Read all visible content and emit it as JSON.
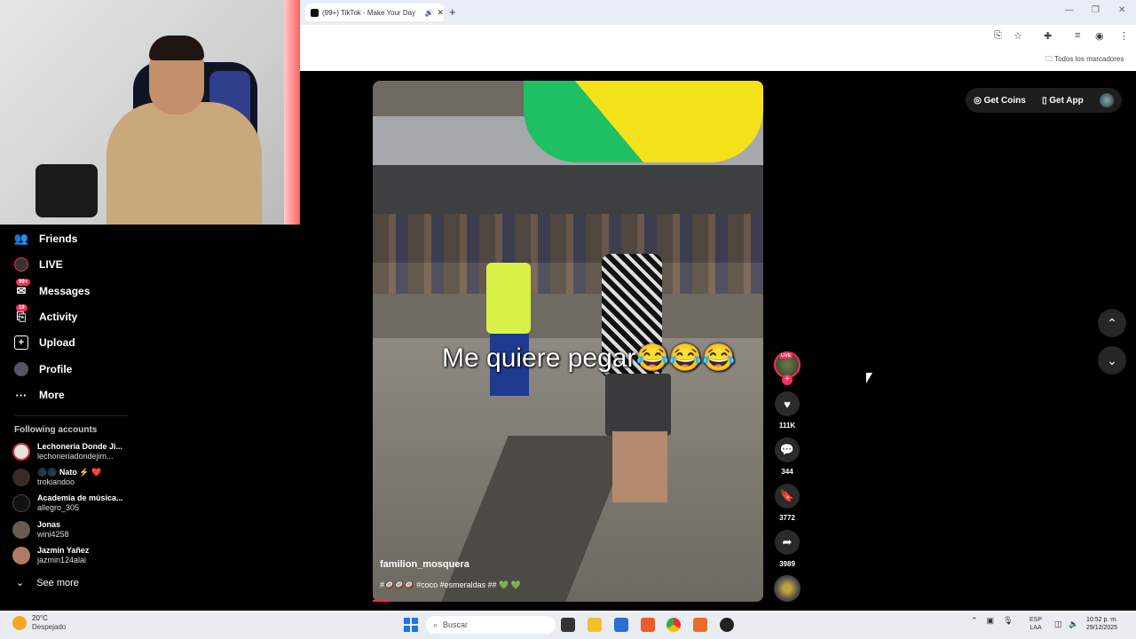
{
  "browser": {
    "tab_title": "(99+) TikTok - Make Your Day",
    "new_tab": "+",
    "tab_close": "✕",
    "bookmarks_label": "Todos los marcadores",
    "window_controls": [
      "—",
      "❐",
      "✕"
    ]
  },
  "sidebar": {
    "nav": [
      {
        "label": "Friends",
        "icon": "friends-icon",
        "badge": ""
      },
      {
        "label": "LIVE",
        "icon": "live-icon",
        "badge": ""
      },
      {
        "label": "Messages",
        "icon": "messages-icon",
        "badge": "99+"
      },
      {
        "label": "Activity",
        "icon": "activity-icon",
        "badge": "19"
      },
      {
        "label": "Upload",
        "icon": "upload-icon",
        "badge": ""
      },
      {
        "label": "Profile",
        "icon": "profile-icon",
        "badge": ""
      },
      {
        "label": "More",
        "icon": "more-icon",
        "badge": ""
      }
    ],
    "following_header": "Following accounts",
    "accounts": [
      {
        "name": "Lechoneria Donde Ji...",
        "handle": "lechoneriadondejim...",
        "color": "#e8e2dc"
      },
      {
        "name": "Nato",
        "handle": "trokiandoo",
        "color": "#3a2a2a"
      },
      {
        "name": "Academia de música...",
        "handle": "allegro_305",
        "color": "#121212"
      },
      {
        "name": "Jonas",
        "handle": "wini4258",
        "color": "#6a5a50"
      },
      {
        "name": "Jazmin Yañez",
        "handle": "jazmin124alai",
        "color": "#b07a66"
      }
    ],
    "see_more": "See more"
  },
  "video": {
    "caption": "Me quiere pegar😂😂😂",
    "username": "familion_mosquera",
    "description": "#🥥🥥🥥 #coco #esmeraldas ## 💚 💚",
    "progress": 0.04
  },
  "actions": {
    "live_tag": "LIVE",
    "follow": "+",
    "likes": "111K",
    "comments": "344",
    "saves": "3772",
    "shares": "3989"
  },
  "topbar": {
    "get_coins": "Get Coins",
    "get_app": "Get App"
  },
  "taskbar": {
    "weather_temp": "20°C",
    "weather_desc": "Despejado",
    "search_placeholder": "Buscar",
    "lang_top": "ESP",
    "lang_bottom": "LAA",
    "time": "10:52 p. m.",
    "date": "29/12/2025"
  },
  "colors": {
    "accent": "#fe2c55",
    "background": "#000000",
    "taskbar": "#e9ecf1"
  }
}
